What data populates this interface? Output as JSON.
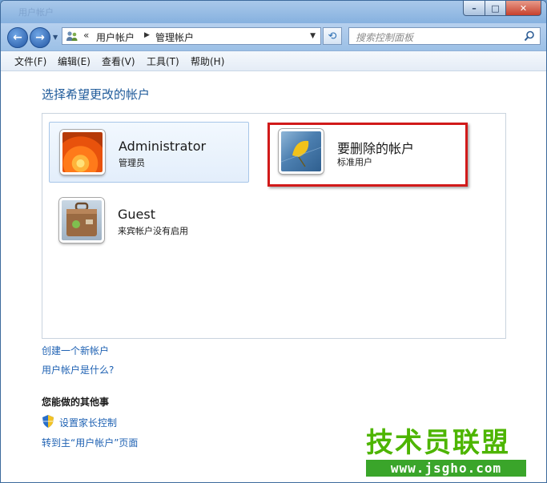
{
  "window": {
    "title": "用户帐户",
    "caption_buttons": {
      "minimize": "–",
      "maximize": "□",
      "close": "✕"
    }
  },
  "navbar": {
    "overflow_chevron": "«",
    "breadcrumbs": [
      "用户帐户",
      "管理帐户"
    ],
    "search_placeholder": "搜索控制面板"
  },
  "menu": [
    "文件(F)",
    "编辑(E)",
    "查看(V)",
    "工具(T)",
    "帮助(H)"
  ],
  "main": {
    "heading": "选择希望更改的帐户",
    "accounts": [
      {
        "name": "Administrator",
        "type": "管理员",
        "avatar": "flower-avatar-icon"
      },
      {
        "name": "要删除的帐户",
        "type": "标准用户",
        "avatar": "leaf-avatar-icon"
      },
      {
        "name": "Guest",
        "type": "来宾帐户没有启用",
        "avatar": "suitcase-avatar-icon"
      }
    ],
    "links": [
      "创建一个新帐户",
      "用户帐户是什么?"
    ],
    "other_heading": "您能做的其他事",
    "other_links": [
      "设置家长控制",
      "转到主“用户帐户”页面"
    ]
  },
  "watermark": {
    "text": "技术员联盟",
    "url": "www.jsgho.com"
  },
  "colors": {
    "highlight": "#d11a1a",
    "link": "#1f62b3",
    "heading": "#1e5a9a",
    "watermark": "#4db500"
  }
}
